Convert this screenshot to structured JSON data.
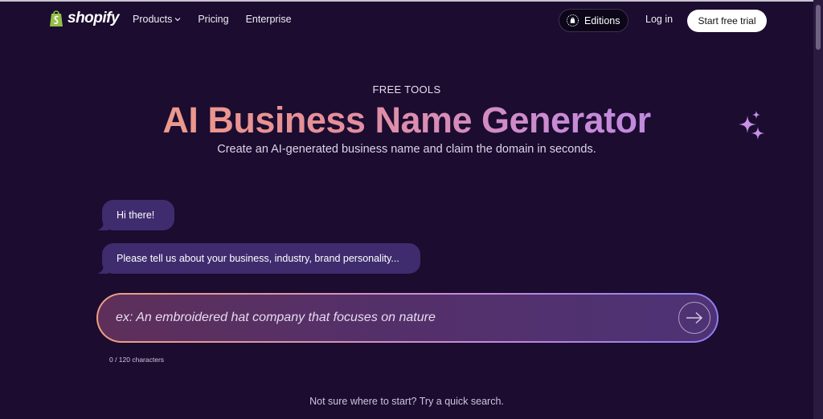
{
  "brand": {
    "name": "shopify"
  },
  "nav": {
    "links": [
      {
        "label": "Products",
        "has_dropdown": true
      },
      {
        "label": "Pricing",
        "has_dropdown": false
      },
      {
        "label": "Enterprise",
        "has_dropdown": false
      }
    ],
    "editions_label": "Editions",
    "login_label": "Log in",
    "trial_label": "Start free trial"
  },
  "hero": {
    "eyebrow": "FREE TOOLS",
    "title": "AI Business Name Generator",
    "subtitle": "Create an AI-generated business name and claim the domain in seconds."
  },
  "chat": {
    "messages": [
      {
        "text": "Hi there!"
      },
      {
        "text": "Please tell us about your business, industry, brand personality..."
      }
    ]
  },
  "input": {
    "value": "",
    "placeholder": "ex: An embroidered hat company that focuses on nature",
    "counter": "0 / 120 characters"
  },
  "footer": {
    "quick_search": "Not sure where to start? Try a quick search."
  },
  "colors": {
    "background": "#1b0c30",
    "bubble": "#3e2c6e",
    "title_gradient_start": "#f2a37c",
    "title_gradient_end": "#b08ae6",
    "shopify_green": "#95bf47"
  }
}
